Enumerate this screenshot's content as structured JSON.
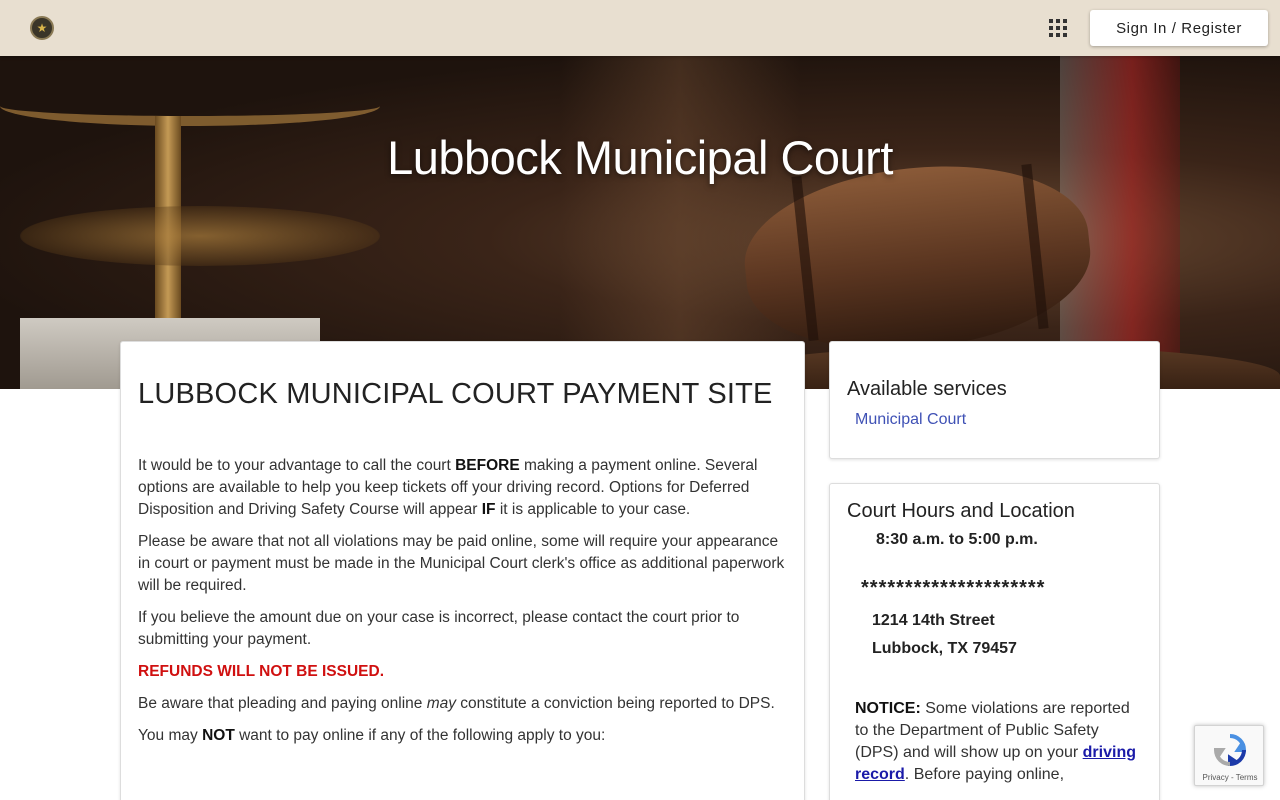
{
  "header": {
    "logo_icon": "court-seal-star",
    "apps_icon": "grid-apps-icon",
    "signin_label": "Sign In / Register"
  },
  "hero": {
    "title": "Lubbock Municipal Court"
  },
  "main": {
    "heading": "LUBBOCK MUNICIPAL COURT PAYMENT SITE",
    "p1_a": "It would be to your advantage to call the court ",
    "p1_b": "BEFORE",
    "p1_c": " making a payment online.  Several options are available to help you keep tickets off your driving record.  Options for Deferred Disposition and Driving Safety Course will appear ",
    "p1_d": "IF",
    "p1_e": " it is applicable to your case.",
    "p2": "Please be aware that not all violations may be paid online, some will require your appearance in court or payment must be made in the Municipal Court clerk's office as additional paperwork will be required.",
    "p3": "If you believe the amount due on your case is incorrect, please contact the court prior to submitting your payment.",
    "p4": "REFUNDS WILL NOT BE ISSUED.",
    "p5_a": "Be aware that pleading and paying online ",
    "p5_b": "may",
    "p5_c": " constitute a conviction being reported to DPS.",
    "p6_a": " You may ",
    "p6_b": "NOT",
    "p6_c": " want to pay online if any of the following apply to you:"
  },
  "services": {
    "heading": "Available services",
    "link": "Municipal Court"
  },
  "hours": {
    "heading": "Court Hours and Location",
    "time": "8:30 a.m. to 5:00 p.m.",
    "stars": "*********************",
    "street": "1214 14th Street",
    "city": "Lubbock, TX 79457",
    "notice_label": "NOTICE:",
    "notice_text": " Some violations are reported to the Department of Public Safety (DPS) and will show up on your ",
    "notice_link": "driving record",
    "notice_tail": ".  Before paying online,"
  },
  "recaptcha": {
    "text": "Privacy - Terms"
  },
  "colors": {
    "topbar": "#e8dfd0",
    "link": "#3f51b5",
    "warning": "#d01010"
  }
}
